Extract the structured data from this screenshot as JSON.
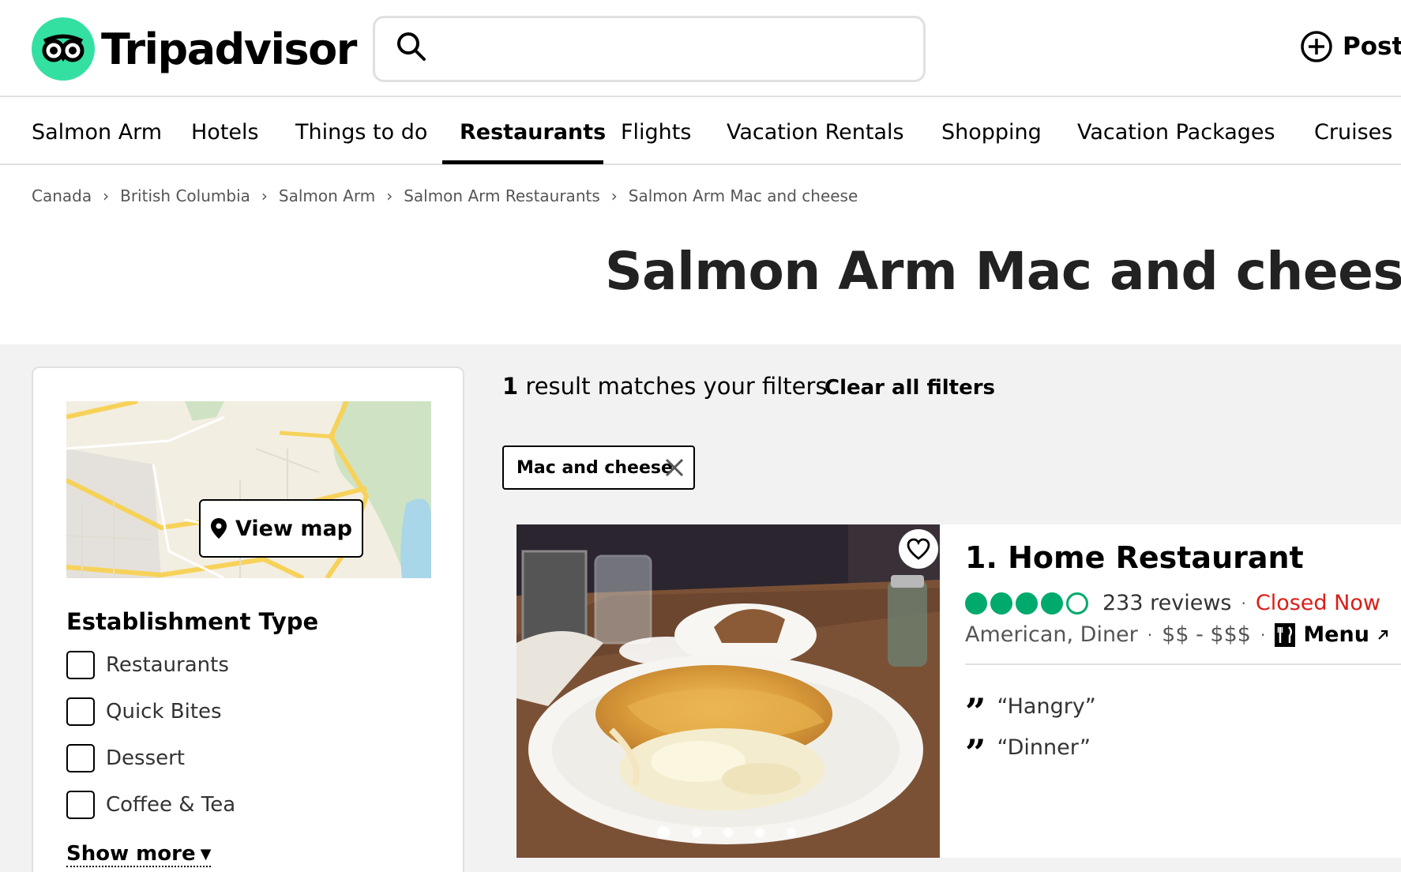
{
  "header": {
    "brand": "Tripadvisor",
    "search_placeholder": "",
    "post_label": "Post"
  },
  "nav": {
    "items": [
      {
        "label": "Salmon Arm"
      },
      {
        "label": "Hotels"
      },
      {
        "label": "Things to do"
      },
      {
        "label": "Restaurants",
        "active": true
      },
      {
        "label": "Flights"
      },
      {
        "label": "Vacation Rentals"
      },
      {
        "label": "Shopping"
      },
      {
        "label": "Vacation Packages"
      },
      {
        "label": "Cruises"
      }
    ]
  },
  "breadcrumb": [
    "Canada",
    "British Columbia",
    "Salmon Arm",
    "Salmon Arm Restaurants",
    "Salmon Arm Mac and cheese"
  ],
  "page_title": "Salmon Arm Mac and cheese",
  "filters": {
    "view_map_label": "View map",
    "establishment_title": "Establishment Type",
    "options": [
      "Restaurants",
      "Quick Bites",
      "Dessert",
      "Coffee & Tea"
    ],
    "show_more_label": "Show more"
  },
  "results": {
    "count": "1",
    "count_text": "result matches your filters",
    "clear_all_label": "Clear all filters",
    "active_filter_chip": "Mac and cheese"
  },
  "listing": {
    "name": "1. Home Restaurant",
    "rating": 4,
    "rating_max": 5,
    "reviews": "233 reviews",
    "status": "Closed Now",
    "cuisine": "American, Diner",
    "price": "$$ - $$$",
    "menu_label": "Menu",
    "quotes": [
      "“Hangry”",
      "“Dinner”"
    ],
    "photo_count": 5,
    "photo_index": 1
  },
  "colors": {
    "brand_green": "#34e0a1",
    "rating_green": "#00aa6c",
    "closed_red": "#d91e18"
  }
}
